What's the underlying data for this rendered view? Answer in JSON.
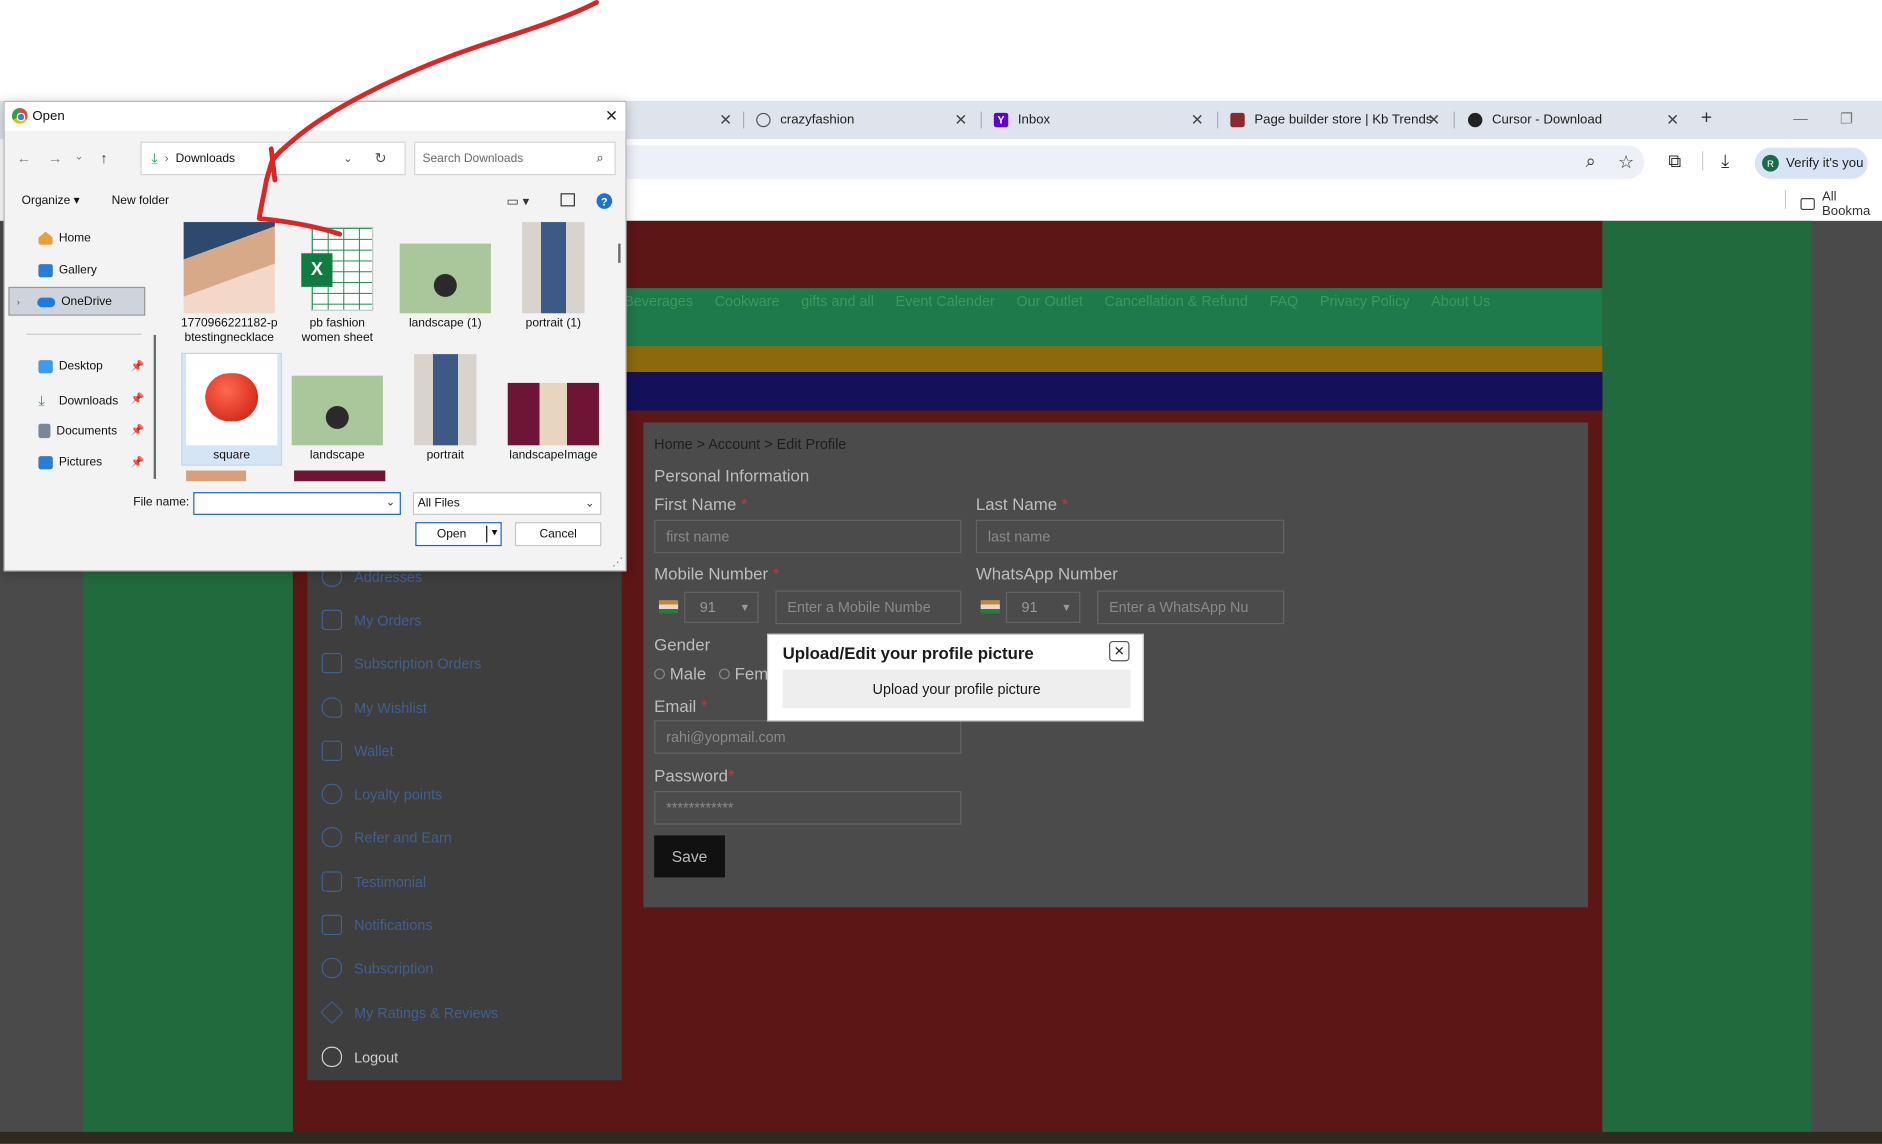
{
  "browser": {
    "tabs": [
      {
        "label": "crazyfashion",
        "icon": "globe-icon"
      },
      {
        "label": "Inbox",
        "icon": "yahoo-mail-icon"
      },
      {
        "label": "Page builder store | Kb Trends",
        "icon": "store-favicon"
      },
      {
        "label": "Cursor - Download",
        "icon": "cursor-favicon"
      }
    ],
    "tab_close": "✕",
    "new_tab": "+",
    "profile_label": "Verify it's you",
    "profile_initial": "R",
    "bookmarks_label": "All Bookma"
  },
  "site": {
    "nav_links": [
      "Beverages",
      "Cookware",
      "gifts and all",
      "Event Calender",
      "Our Outlet",
      "Cancellation & Refund",
      "FAQ",
      "Privacy Policy",
      "About Us"
    ],
    "sidebar": [
      "Addresses",
      "My Orders",
      "Subscription Orders",
      "My Wishlist",
      "Wallet",
      "Loyalty points",
      "Refer and Earn",
      "Testimonial",
      "Notifications",
      "Subscription",
      "My Ratings & Reviews",
      "Logout"
    ],
    "breadcrumb": "Home > Account > Edit Profile",
    "section_title": "Personal Information",
    "form": {
      "first_name_label": "First Name",
      "first_name_placeholder": "first name",
      "last_name_label": "Last Name",
      "last_name_placeholder": "last name",
      "mobile_label": "Mobile Number",
      "mobile_code": "91",
      "mobile_placeholder": "Enter a Mobile Numbe",
      "whatsapp_label": "WhatsApp Number",
      "whatsapp_code": "91",
      "whatsapp_placeholder": "Enter a WhatsApp Nu",
      "gender_label": "Gender",
      "gender_male": "Male",
      "gender_female": "Fem",
      "email_label": "Email",
      "email_value": "rahi@yopmail.com",
      "password_label": "Password",
      "password_value": "************",
      "required_mark": "*",
      "save_label": "Save"
    }
  },
  "profile_modal": {
    "title": "Upload/Edit your profile picture",
    "upload_label": "Upload your profile picture"
  },
  "dialog": {
    "title": "Open",
    "address": "Downloads",
    "search_placeholder": "Search Downloads",
    "organize_label": "Organize ▾",
    "new_folder_label": "New folder",
    "nav_items": {
      "home": "Home",
      "gallery": "Gallery",
      "onedrive": "OneDrive",
      "desktop": "Desktop",
      "downloads": "Downloads",
      "documents": "Documents",
      "pictures": "Pictures"
    },
    "files": [
      {
        "name": "1770966221182-pbtestingnecklace",
        "line1": "1770966221182-p",
        "line2": "btestingnecklace"
      },
      {
        "name": "pb fashion women sheet",
        "line1": "pb fashion",
        "line2": "women sheet"
      },
      {
        "name": "landscape (1)",
        "line1": "landscape (1)",
        "line2": ""
      },
      {
        "name": "portrait (1)",
        "line1": "portrait (1)",
        "line2": ""
      },
      {
        "name": "square",
        "line1": "square",
        "line2": ""
      },
      {
        "name": "landscape",
        "line1": "landscape",
        "line2": ""
      },
      {
        "name": "portrait",
        "line1": "portrait",
        "line2": ""
      },
      {
        "name": "landscapeImage",
        "line1": "landscapeImage",
        "line2": ""
      }
    ],
    "file_name_label": "File name:",
    "file_name_value": "",
    "file_type": "All Files",
    "open_label": "Open",
    "cancel_label": "Cancel"
  },
  "colors": {
    "annotation": "#e02424",
    "accent_blue": "#1a62c4",
    "page_green": "#216a3d",
    "page_red": "#5c1616"
  }
}
